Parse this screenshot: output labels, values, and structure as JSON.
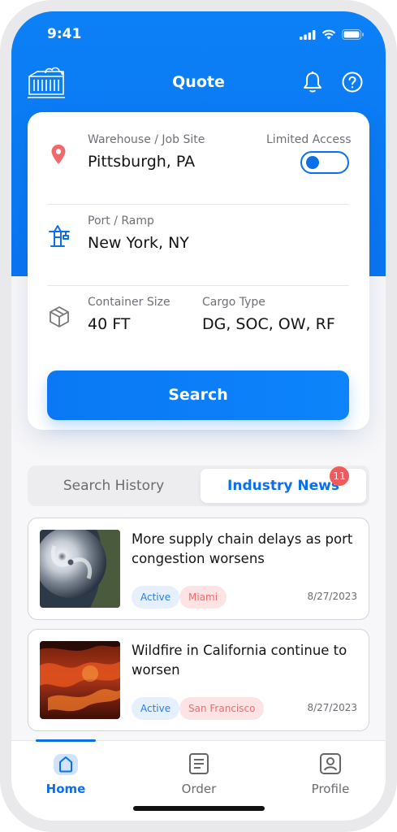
{
  "status_bar": {
    "time": "9:41"
  },
  "header": {
    "title": "Quote"
  },
  "quote": {
    "origin": {
      "label": "Warehouse / Job Site",
      "value": "Pittsburgh, PA"
    },
    "limited_access": {
      "label": "Limited Access",
      "enabled": true
    },
    "destination": {
      "label": "Port / Ramp",
      "value": "New York, NY"
    },
    "container": {
      "label": "Container Size",
      "value": "40 FT"
    },
    "cargo": {
      "label": "Cargo Type",
      "value": "DG, SOC, OW, RF"
    },
    "search_label": "Search"
  },
  "tabs": {
    "history_label": "Search History",
    "news_label": "Industry News",
    "news_badge": "11",
    "active": "news"
  },
  "news": [
    {
      "title": "More supply chain delays as port congestion worsens",
      "status": "Active",
      "location": "Miami",
      "date": "8/27/2023",
      "image": "hurricane-satellite-photo"
    },
    {
      "title": "Wildfire in California continue to worsen",
      "status": "Active",
      "location": "San Francisco",
      "date": "8/27/2023",
      "image": "wildfire-photo"
    }
  ],
  "tabbar": {
    "items": [
      {
        "label": "Home",
        "icon": "home-icon"
      },
      {
        "label": "Order",
        "icon": "order-icon"
      },
      {
        "label": "Profile",
        "icon": "profile-icon"
      }
    ],
    "active": "Home"
  },
  "colors": {
    "primary": "#0B74F2",
    "header_bg": "#0C80F6",
    "badge": "#F05A5A",
    "chip_status_bg": "#E6F0FC",
    "chip_location_bg": "#FDE3E3"
  }
}
